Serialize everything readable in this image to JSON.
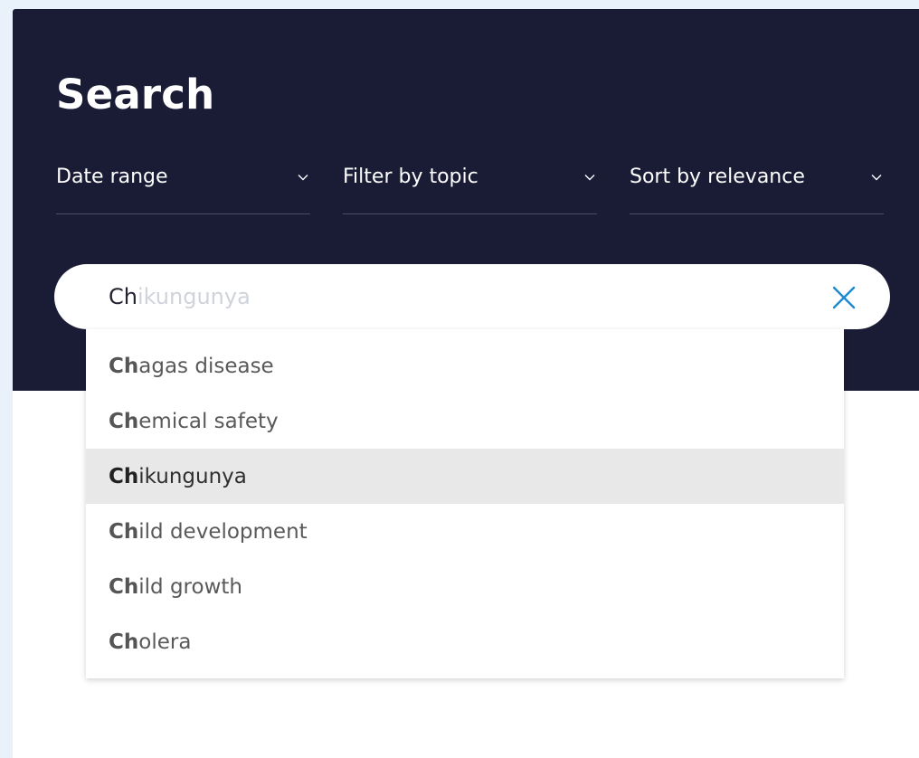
{
  "page": {
    "title": "Search"
  },
  "filters": [
    {
      "label": "Date range"
    },
    {
      "label": "Filter by topic"
    },
    {
      "label": "Sort by relevance"
    }
  ],
  "search": {
    "typed_value": "Ch",
    "ghost_completion": "ikungunya",
    "clear_icon": "close-icon"
  },
  "suggestions": {
    "highlighted_index": 2,
    "items": [
      {
        "match": "Ch",
        "rest": "agas disease"
      },
      {
        "match": "Ch",
        "rest": "emical safety"
      },
      {
        "match": "Ch",
        "rest": "ikungunya"
      },
      {
        "match": "Ch",
        "rest": "ild development"
      },
      {
        "match": "Ch",
        "rest": "ild growth"
      },
      {
        "match": "Ch",
        "rest": "olera"
      }
    ]
  },
  "colors": {
    "hero_background": "#1a1c36",
    "accent": "#1c8ad1",
    "highlight_row": "#e8e8e8"
  }
}
